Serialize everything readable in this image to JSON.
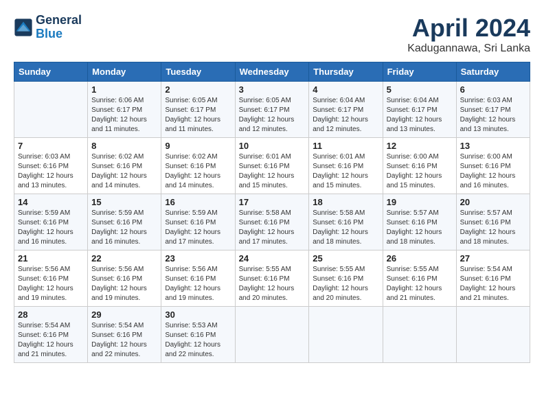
{
  "logo": {
    "line1": "General",
    "line2": "Blue"
  },
  "header": {
    "title": "April 2024",
    "location": "Kadugannawa, Sri Lanka"
  },
  "days_of_week": [
    "Sunday",
    "Monday",
    "Tuesday",
    "Wednesday",
    "Thursday",
    "Friday",
    "Saturday"
  ],
  "weeks": [
    [
      {
        "day": "",
        "info": ""
      },
      {
        "day": "1",
        "info": "Sunrise: 6:06 AM\nSunset: 6:17 PM\nDaylight: 12 hours\nand 11 minutes."
      },
      {
        "day": "2",
        "info": "Sunrise: 6:05 AM\nSunset: 6:17 PM\nDaylight: 12 hours\nand 11 minutes."
      },
      {
        "day": "3",
        "info": "Sunrise: 6:05 AM\nSunset: 6:17 PM\nDaylight: 12 hours\nand 12 minutes."
      },
      {
        "day": "4",
        "info": "Sunrise: 6:04 AM\nSunset: 6:17 PM\nDaylight: 12 hours\nand 12 minutes."
      },
      {
        "day": "5",
        "info": "Sunrise: 6:04 AM\nSunset: 6:17 PM\nDaylight: 12 hours\nand 13 minutes."
      },
      {
        "day": "6",
        "info": "Sunrise: 6:03 AM\nSunset: 6:17 PM\nDaylight: 12 hours\nand 13 minutes."
      }
    ],
    [
      {
        "day": "7",
        "info": "Sunrise: 6:03 AM\nSunset: 6:16 PM\nDaylight: 12 hours\nand 13 minutes."
      },
      {
        "day": "8",
        "info": "Sunrise: 6:02 AM\nSunset: 6:16 PM\nDaylight: 12 hours\nand 14 minutes."
      },
      {
        "day": "9",
        "info": "Sunrise: 6:02 AM\nSunset: 6:16 PM\nDaylight: 12 hours\nand 14 minutes."
      },
      {
        "day": "10",
        "info": "Sunrise: 6:01 AM\nSunset: 6:16 PM\nDaylight: 12 hours\nand 15 minutes."
      },
      {
        "day": "11",
        "info": "Sunrise: 6:01 AM\nSunset: 6:16 PM\nDaylight: 12 hours\nand 15 minutes."
      },
      {
        "day": "12",
        "info": "Sunrise: 6:00 AM\nSunset: 6:16 PM\nDaylight: 12 hours\nand 15 minutes."
      },
      {
        "day": "13",
        "info": "Sunrise: 6:00 AM\nSunset: 6:16 PM\nDaylight: 12 hours\nand 16 minutes."
      }
    ],
    [
      {
        "day": "14",
        "info": "Sunrise: 5:59 AM\nSunset: 6:16 PM\nDaylight: 12 hours\nand 16 minutes."
      },
      {
        "day": "15",
        "info": "Sunrise: 5:59 AM\nSunset: 6:16 PM\nDaylight: 12 hours\nand 16 minutes."
      },
      {
        "day": "16",
        "info": "Sunrise: 5:59 AM\nSunset: 6:16 PM\nDaylight: 12 hours\nand 17 minutes."
      },
      {
        "day": "17",
        "info": "Sunrise: 5:58 AM\nSunset: 6:16 PM\nDaylight: 12 hours\nand 17 minutes."
      },
      {
        "day": "18",
        "info": "Sunrise: 5:58 AM\nSunset: 6:16 PM\nDaylight: 12 hours\nand 18 minutes."
      },
      {
        "day": "19",
        "info": "Sunrise: 5:57 AM\nSunset: 6:16 PM\nDaylight: 12 hours\nand 18 minutes."
      },
      {
        "day": "20",
        "info": "Sunrise: 5:57 AM\nSunset: 6:16 PM\nDaylight: 12 hours\nand 18 minutes."
      }
    ],
    [
      {
        "day": "21",
        "info": "Sunrise: 5:56 AM\nSunset: 6:16 PM\nDaylight: 12 hours\nand 19 minutes."
      },
      {
        "day": "22",
        "info": "Sunrise: 5:56 AM\nSunset: 6:16 PM\nDaylight: 12 hours\nand 19 minutes."
      },
      {
        "day": "23",
        "info": "Sunrise: 5:56 AM\nSunset: 6:16 PM\nDaylight: 12 hours\nand 19 minutes."
      },
      {
        "day": "24",
        "info": "Sunrise: 5:55 AM\nSunset: 6:16 PM\nDaylight: 12 hours\nand 20 minutes."
      },
      {
        "day": "25",
        "info": "Sunrise: 5:55 AM\nSunset: 6:16 PM\nDaylight: 12 hours\nand 20 minutes."
      },
      {
        "day": "26",
        "info": "Sunrise: 5:55 AM\nSunset: 6:16 PM\nDaylight: 12 hours\nand 21 minutes."
      },
      {
        "day": "27",
        "info": "Sunrise: 5:54 AM\nSunset: 6:16 PM\nDaylight: 12 hours\nand 21 minutes."
      }
    ],
    [
      {
        "day": "28",
        "info": "Sunrise: 5:54 AM\nSunset: 6:16 PM\nDaylight: 12 hours\nand 21 minutes."
      },
      {
        "day": "29",
        "info": "Sunrise: 5:54 AM\nSunset: 6:16 PM\nDaylight: 12 hours\nand 22 minutes."
      },
      {
        "day": "30",
        "info": "Sunrise: 5:53 AM\nSunset: 6:16 PM\nDaylight: 12 hours\nand 22 minutes."
      },
      {
        "day": "",
        "info": ""
      },
      {
        "day": "",
        "info": ""
      },
      {
        "day": "",
        "info": ""
      },
      {
        "day": "",
        "info": ""
      }
    ]
  ]
}
